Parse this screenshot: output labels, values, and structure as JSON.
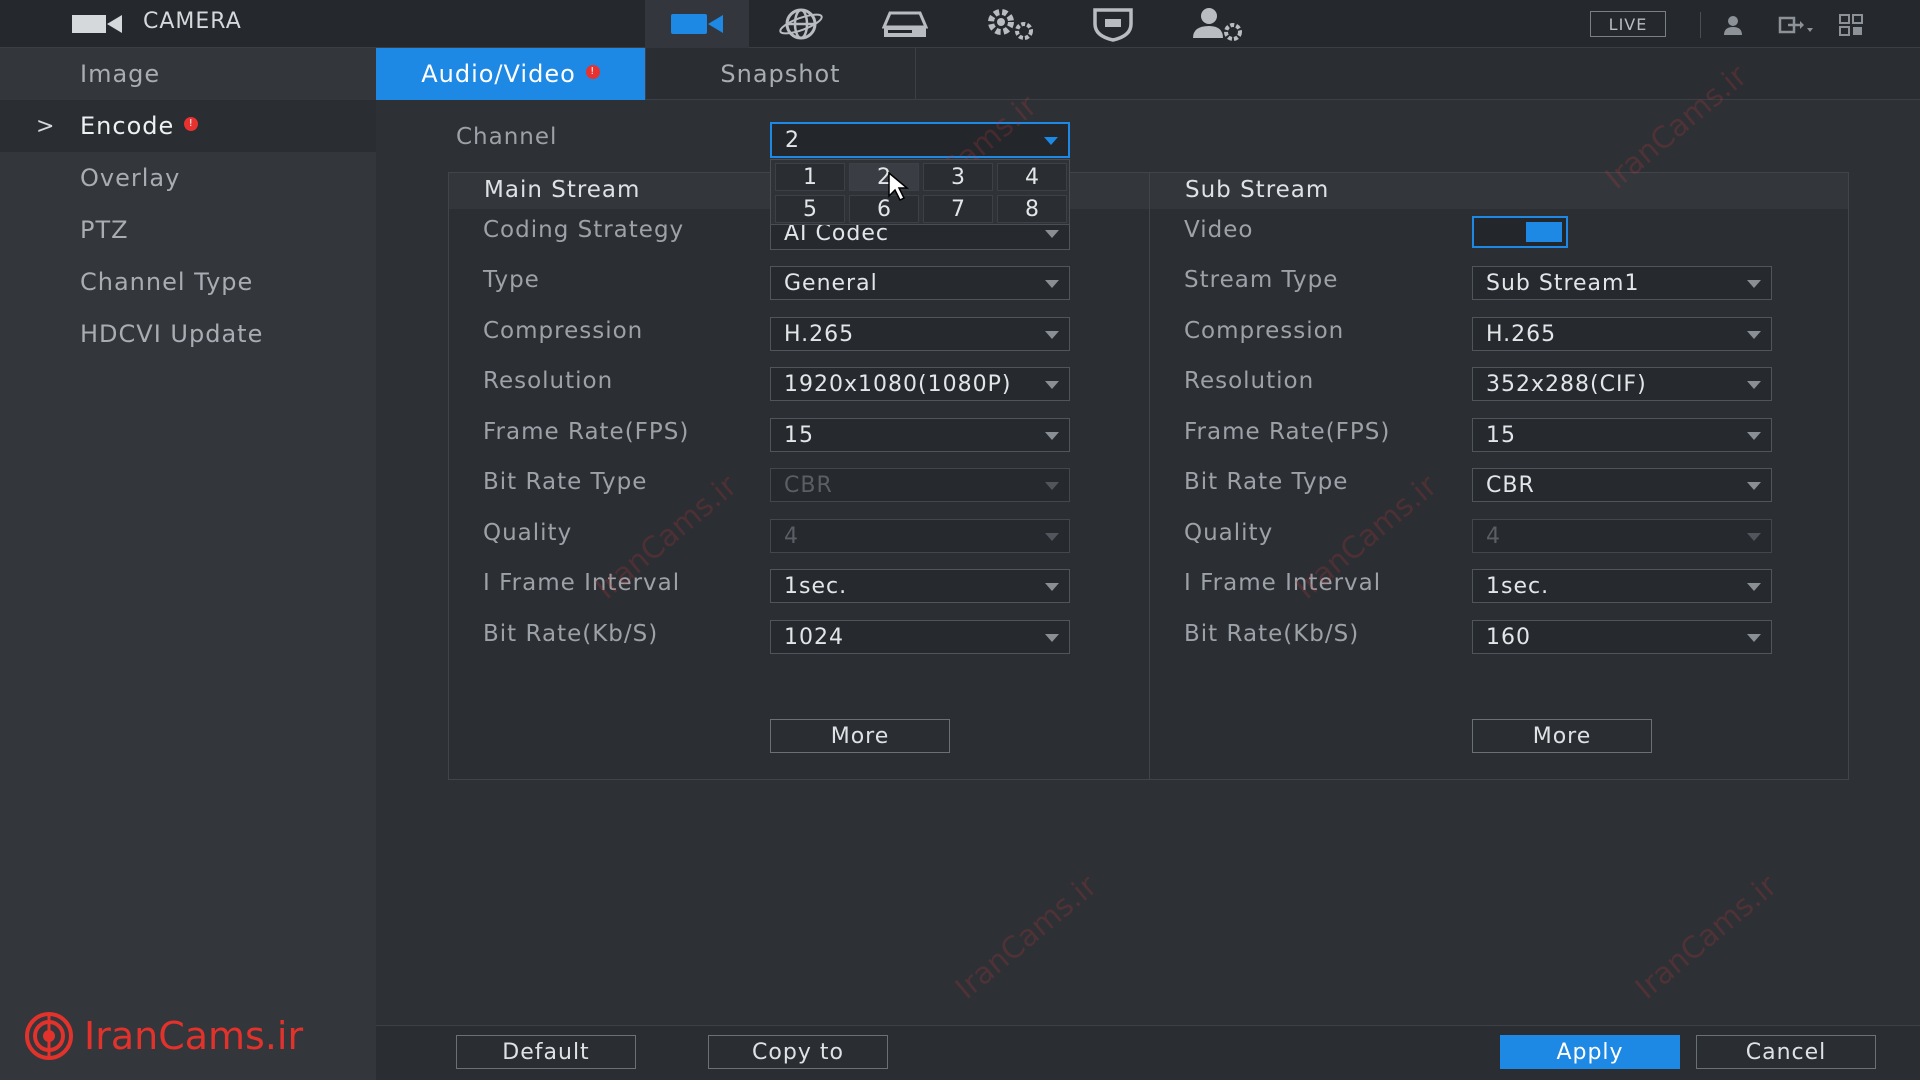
{
  "topbar": {
    "title": "CAMERA",
    "live_label": "LIVE",
    "nav": [
      {
        "icon": "camera-icon",
        "active": true
      },
      {
        "icon": "network-globe-icon",
        "active": false
      },
      {
        "icon": "storage-hdd-icon",
        "active": false
      },
      {
        "icon": "system-gears-icon",
        "active": false
      },
      {
        "icon": "security-shield-icon",
        "active": false
      },
      {
        "icon": "account-settings-icon",
        "active": false
      }
    ]
  },
  "sidebar": {
    "items": [
      {
        "label": "Image"
      },
      {
        "label": "Encode",
        "active": true,
        "badge": "!"
      },
      {
        "label": "Overlay"
      },
      {
        "label": "PTZ"
      },
      {
        "label": "Channel Type"
      },
      {
        "label": "HDCVI Update"
      }
    ],
    "caret": ">"
  },
  "tabs": [
    {
      "label": "Audio/Video",
      "active": true,
      "badge": "!"
    },
    {
      "label": "Snapshot"
    }
  ],
  "channel": {
    "label": "Channel",
    "value": "2",
    "options": [
      "1",
      "2",
      "3",
      "4",
      "5",
      "6",
      "7",
      "8"
    ]
  },
  "main_stream": {
    "title": "Main Stream",
    "fields": [
      {
        "label": "Coding Strategy",
        "value": "AI Codec"
      },
      {
        "label": "Type",
        "value": "General"
      },
      {
        "label": "Compression",
        "value": "H.265"
      },
      {
        "label": "Resolution",
        "value": "1920x1080(1080P)"
      },
      {
        "label": "Frame Rate(FPS)",
        "value": "15"
      },
      {
        "label": "Bit Rate Type",
        "value": "CBR",
        "disabled": true
      },
      {
        "label": "Quality",
        "value": "4",
        "disabled": true
      },
      {
        "label": "I Frame Interval",
        "value": "1sec."
      },
      {
        "label": "Bit Rate(Kb/S)",
        "value": "1024"
      }
    ],
    "more_label": "More"
  },
  "sub_stream": {
    "title": "Sub Stream",
    "video_label": "Video",
    "video_enabled": true,
    "fields": [
      {
        "label": "Stream Type",
        "value": "Sub Stream1"
      },
      {
        "label": "Compression",
        "value": "H.265"
      },
      {
        "label": "Resolution",
        "value": "352x288(CIF)"
      },
      {
        "label": "Frame Rate(FPS)",
        "value": "15"
      },
      {
        "label": "Bit Rate Type",
        "value": "CBR"
      },
      {
        "label": "Quality",
        "value": "4",
        "disabled": true
      },
      {
        "label": "I Frame Interval",
        "value": "1sec."
      },
      {
        "label": "Bit Rate(Kb/S)",
        "value": "160"
      }
    ],
    "more_label": "More"
  },
  "footer": {
    "default_label": "Default",
    "copy_label": "Copy to",
    "apply_label": "Apply",
    "cancel_label": "Cancel"
  },
  "brand": {
    "text": "IranCams.ir"
  },
  "watermark": {
    "text": "IranCams.ir"
  },
  "colors": {
    "accent": "#1e88e5",
    "brand": "#e2322c"
  }
}
